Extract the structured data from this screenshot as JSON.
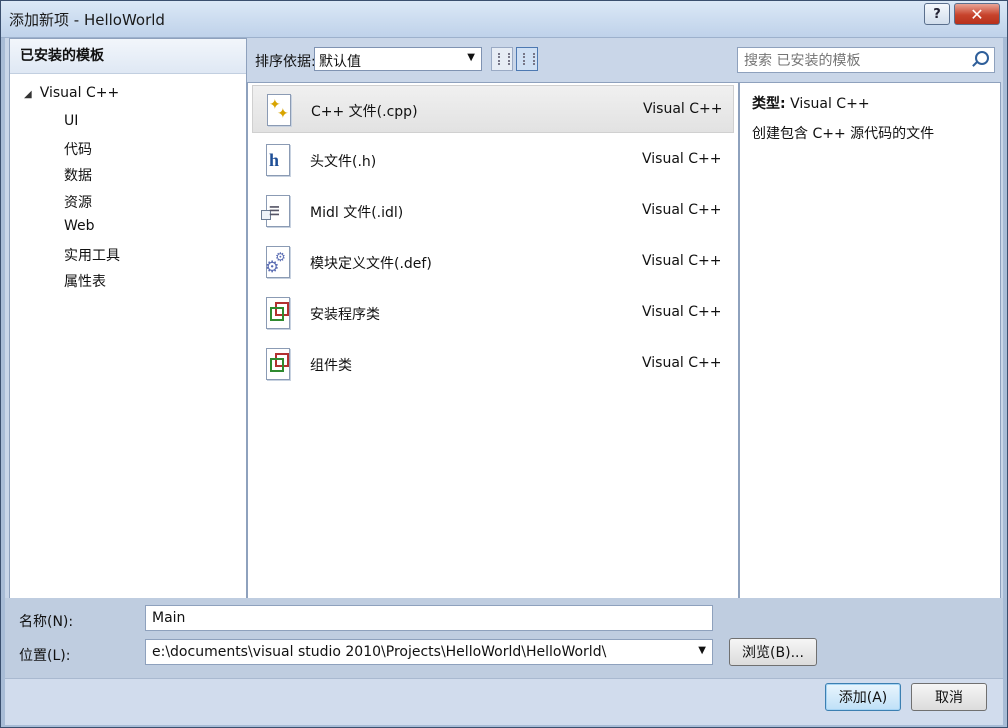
{
  "window": {
    "title": "添加新项 - HelloWorld",
    "help_label": "?",
    "close_label": "✕"
  },
  "left_panel": {
    "header": "已安装的模板",
    "root": {
      "label": "Visual C++",
      "expanded": true
    },
    "items": [
      {
        "label": "UI",
        "selected": false
      },
      {
        "label": "代码",
        "selected": true
      },
      {
        "label": "数据",
        "selected": false
      },
      {
        "label": "资源",
        "selected": false
      },
      {
        "label": "Web",
        "selected": false
      },
      {
        "label": "实用工具",
        "selected": false
      },
      {
        "label": "属性表",
        "selected": false
      }
    ]
  },
  "toolbar": {
    "sort_label": "排序依据:",
    "sort_value": "默认值",
    "view_icons": [
      "small-icons-view-icon",
      "list-view-icon"
    ]
  },
  "search": {
    "placeholder": "搜索 已安装的模板"
  },
  "templates": [
    {
      "name": "C++ 文件(.cpp)",
      "lang": "Visual C++",
      "icon": "cpp-file-icon",
      "selected": true
    },
    {
      "name": "头文件(.h)",
      "lang": "Visual C++",
      "icon": "header-file-icon",
      "selected": false
    },
    {
      "name": "Midl 文件(.idl)",
      "lang": "Visual C++",
      "icon": "midl-file-icon",
      "selected": false
    },
    {
      "name": "模块定义文件(.def)",
      "lang": "Visual C++",
      "icon": "module-def-file-icon",
      "selected": false
    },
    {
      "name": "安装程序类",
      "lang": "Visual C++",
      "icon": "installer-class-icon",
      "selected": false
    },
    {
      "name": "组件类",
      "lang": "Visual C++",
      "icon": "component-class-icon",
      "selected": false
    }
  ],
  "details": {
    "type_label": "类型:",
    "type_value": "Visual C++",
    "description": "创建包含 C++ 源代码的文件"
  },
  "form": {
    "name_label": "名称(N):",
    "name_value": "Main",
    "location_label": "位置(L):",
    "location_value": "e:\\documents\\visual studio 2010\\Projects\\HelloWorld\\HelloWorld\\",
    "browse_label": "浏览(B)..."
  },
  "buttons": {
    "add_label": "添加(A)",
    "cancel_label": "取消"
  }
}
